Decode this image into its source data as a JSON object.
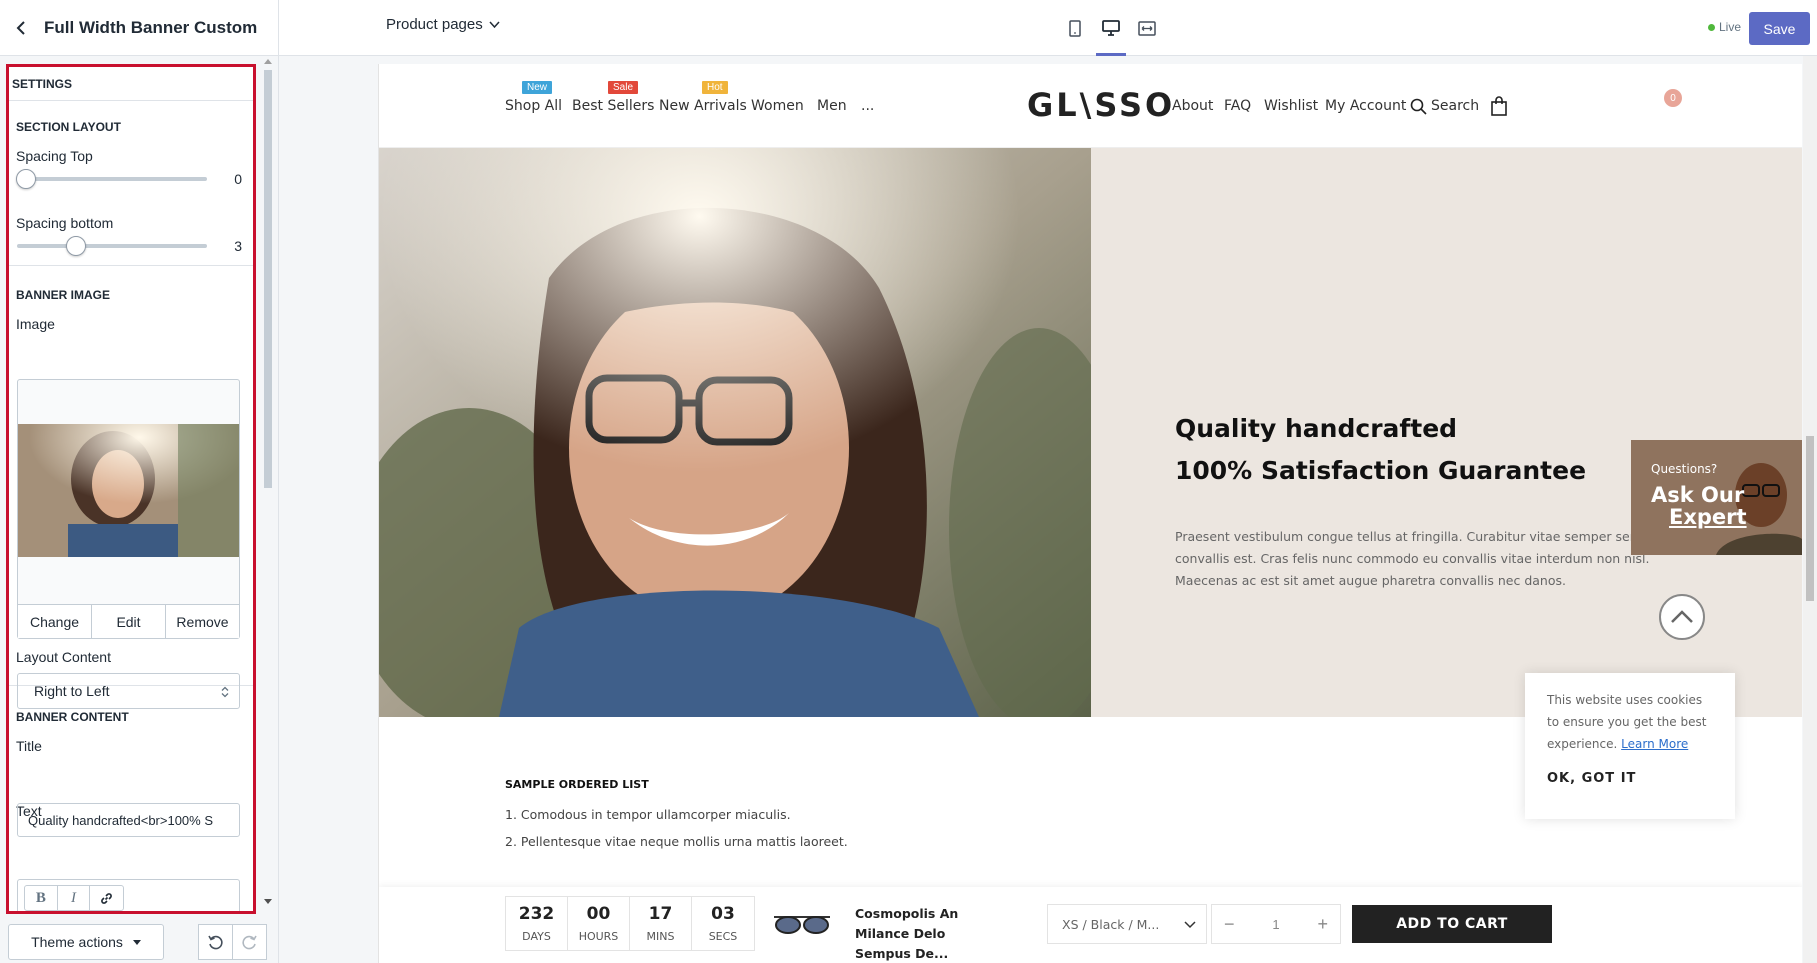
{
  "topbar": {
    "panel_title": "Full Width Banner Custom",
    "page_select": "Product pages",
    "live_label": "Live",
    "save_label": "Save"
  },
  "sidebar": {
    "settings_header": "SETTINGS",
    "section_layout": {
      "header": "SECTION LAYOUT",
      "spacing_top_label": "Spacing Top",
      "spacing_top_value": "0",
      "spacing_bottom_label": "Spacing bottom",
      "spacing_bottom_value": "3"
    },
    "banner_image": {
      "header": "BANNER IMAGE",
      "image_label": "Image",
      "change": "Change",
      "edit": "Edit",
      "remove": "Remove",
      "layout_label": "Layout Content",
      "layout_value": "Right to Left"
    },
    "banner_content": {
      "header": "BANNER CONTENT",
      "title_label": "Title",
      "title_value": "Quality handcrafted<br>100% S",
      "text_label": "Text"
    },
    "theme_actions": "Theme actions"
  },
  "store": {
    "nav": [
      {
        "label": "Shop All",
        "badge": "New",
        "badge_color": "#3ea4d9"
      },
      {
        "label": "Best Sellers",
        "badge": "Sale",
        "badge_color": "#e2483a"
      },
      {
        "label": "New Arrivals",
        "badge": "",
        "badge_color": ""
      },
      {
        "label": "Women",
        "badge": "Hot",
        "badge_color": "#f0b43b"
      },
      {
        "label": "Men",
        "badge": "",
        "badge_color": ""
      },
      {
        "label": "...",
        "badge": "",
        "badge_color": ""
      }
    ],
    "logo": "GL\\SSO",
    "right_nav": [
      "About",
      "FAQ",
      "Wishlist",
      "My Account",
      "Search"
    ],
    "cart_count": "0"
  },
  "hero": {
    "title_line1": "Quality handcrafted",
    "title_line2": "100% Satisfaction Guarantee",
    "text": "Praesent vestibulum congue tellus at fringilla. Curabitur vitae semper sem, eu convallis est. Cras felis nunc commodo eu convallis vitae interdum non nisl. Maecenas ac est sit amet augue pharetra convallis nec danos.",
    "expert_q": "Questions?",
    "expert_line1": "Ask Our",
    "expert_line2": "Expert"
  },
  "cookie": {
    "text": "This website uses cookies to ensure you get the best experience.",
    "link": "Learn More",
    "ok": "OK, GOT IT"
  },
  "list": {
    "title": "SAMPLE ORDERED LIST",
    "items": [
      "1. Comodous in tempor ullamcorper miaculis.",
      "2. Pellentesque vitae neque mollis urna mattis laoreet."
    ]
  },
  "sticky": {
    "countdown": [
      {
        "num": "232",
        "label": "DAYS"
      },
      {
        "num": "00",
        "label": "HOURS"
      },
      {
        "num": "17",
        "label": "MINS"
      },
      {
        "num": "03",
        "label": "SECS"
      }
    ],
    "product_name": "Cosmopolis An Milance Delo Sempus De...",
    "variant": "XS / Black / M...",
    "qty": "1",
    "add_to_cart": "ADD TO CART"
  }
}
